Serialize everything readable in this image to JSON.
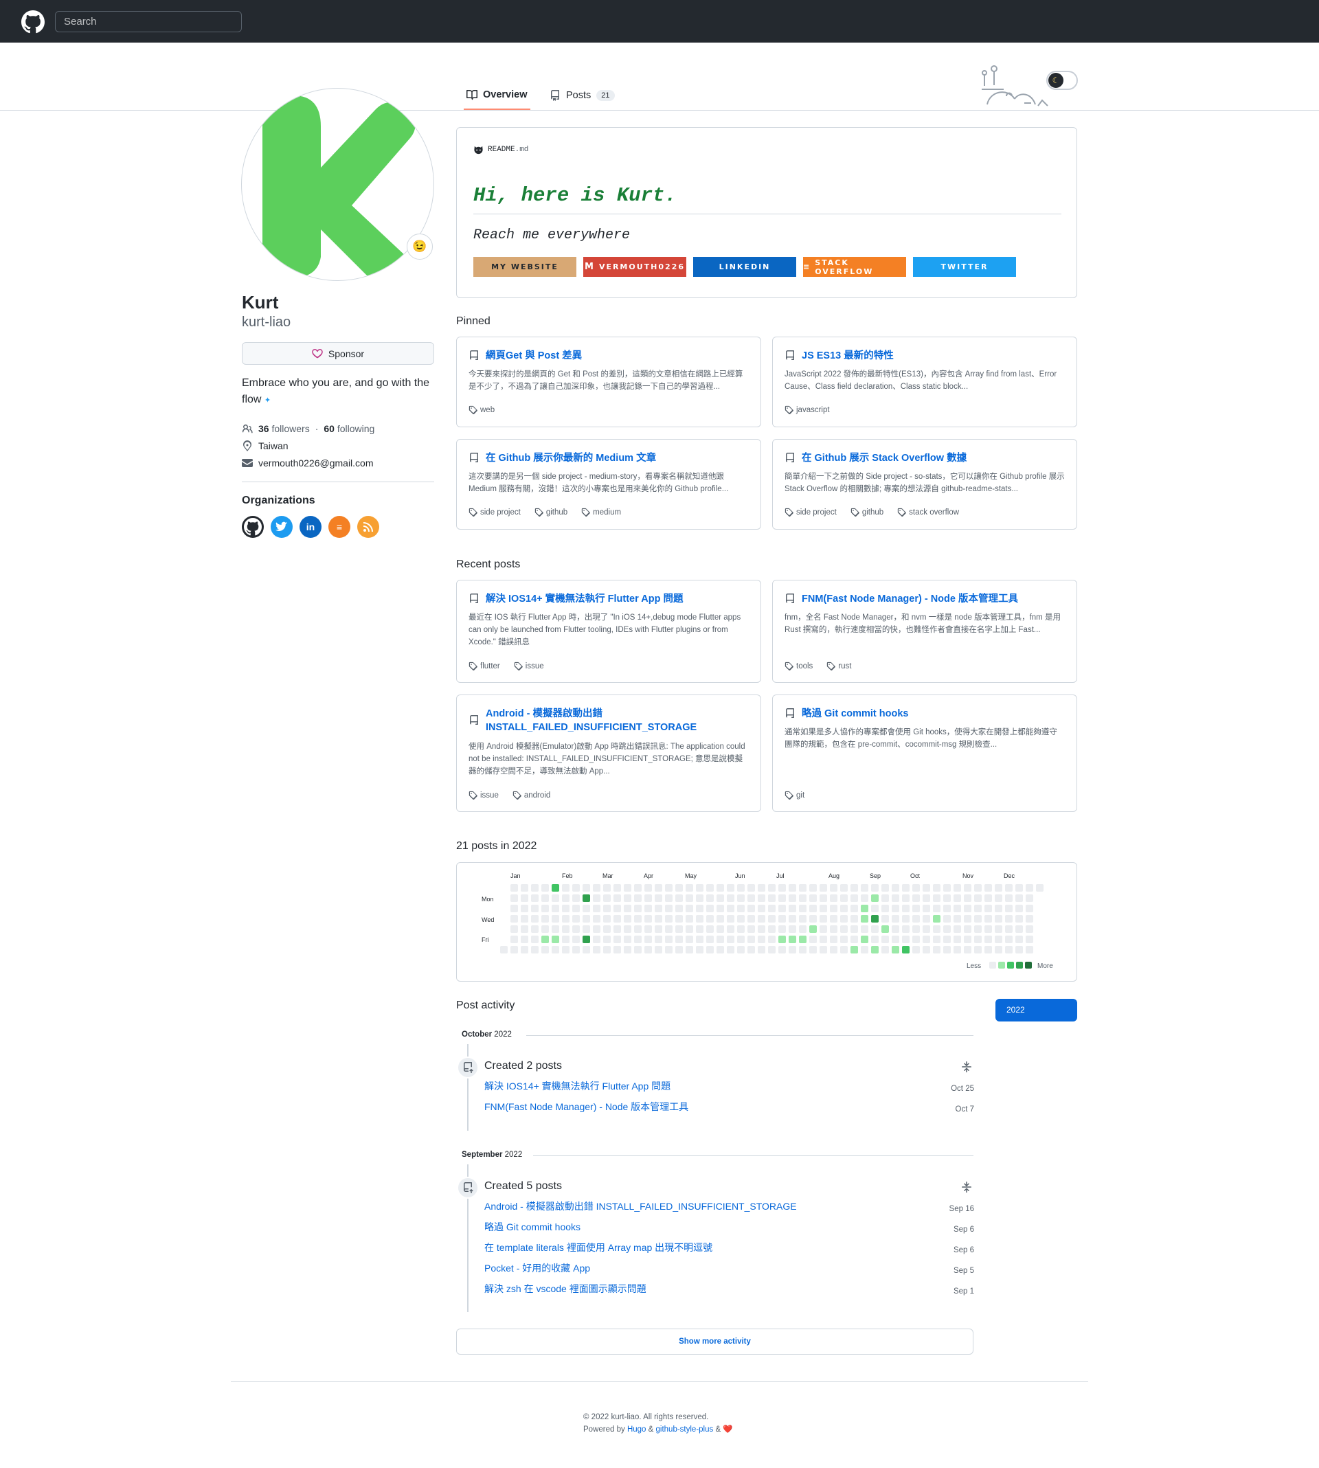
{
  "header": {
    "search_placeholder": "Search"
  },
  "tabs": [
    {
      "label": "Overview"
    },
    {
      "label": "Posts",
      "count": "21"
    }
  ],
  "profile": {
    "name": "Kurt",
    "login": "kurt-liao",
    "status_emoji": "😉",
    "sponsor_label": "Sponsor",
    "bio": "Embrace who you are, and go with the flow",
    "bio_emoji": "✦",
    "followers_count": "36",
    "followers_label": "followers",
    "following_count": "60",
    "following_label": "following",
    "location": "Taiwan",
    "email": "vermouth0226@gmail.com"
  },
  "organizations": {
    "title": "Organizations",
    "items": [
      {
        "name": "github",
        "glyph": "",
        "color": "#24292f"
      },
      {
        "name": "twitter",
        "glyph": "t",
        "color": "#1d9bf0"
      },
      {
        "name": "linkedin",
        "glyph": "in",
        "color": "#0a66c2"
      },
      {
        "name": "stackoverflow",
        "glyph": "≡",
        "color": "#f48024"
      },
      {
        "name": "rss",
        "glyph": "⁾",
        "color": "#f7a032"
      }
    ]
  },
  "readme": {
    "file": "README",
    "ext": ".md",
    "heading": "Hi, here is Kurt.",
    "subheading": "Reach me everywhere",
    "badges": [
      {
        "label": "MY WEBSITE",
        "color": "#d8a874",
        "text_color": "#24292f"
      },
      {
        "label": "VERMOUTH0226",
        "color": "#d44638",
        "text_color": "#ffffff"
      },
      {
        "label": "LINKEDIN",
        "color": "#0a66c2",
        "text_color": "#ffffff"
      },
      {
        "label": "STACK OVERFLOW",
        "color": "#f48024",
        "text_color": "#ffffff"
      },
      {
        "label": "TWITTER",
        "color": "#1da1f2",
        "text_color": "#ffffff"
      }
    ]
  },
  "pinned": {
    "title": "Pinned",
    "items": [
      {
        "title": "網頁Get 與 Post 差異",
        "desc": "今天要來探討的是網頁的 Get 和 Post 的差別，這類的文章相信在網路上已經算是不少了，不過為了讓自己加深印象，也讓我記錄一下自己的學習過程...",
        "tags": [
          "web"
        ]
      },
      {
        "title": "JS ES13 最新的特性",
        "desc": "JavaScript 2022 發佈的最新特性(ES13)，內容包含 Array find from last、Error Cause、Class field declaration、Class static block...",
        "tags": [
          "javascript"
        ]
      },
      {
        "title": "在 Github 展示你最新的 Medium 文章",
        "desc": "這次要講的是另一個 side project - medium-story，看專案名稱就知道他跟 Medium 服務有關，沒錯！這次的小專案也是用來美化你的 Github profile...",
        "tags": [
          "side project",
          "github",
          "medium"
        ]
      },
      {
        "title": "在 Github 展示 Stack Overflow 數據",
        "desc": "簡單介紹一下之前做的 Side project - so-stats，它可以讓你在 Github profile 展示Stack Overflow 的相關數據; 專案的想法源自 github-readme-stats...",
        "tags": [
          "side project",
          "github",
          "stack overflow"
        ]
      }
    ]
  },
  "recent": {
    "title": "Recent posts",
    "items": [
      {
        "title": "解決 IOS14+ 實機無法執行 Flutter App 問題",
        "desc": "最近在 IOS 執行 Flutter App 時，出現了 \"In iOS 14+,debug mode Flutter apps can only be launched from Flutter tooling, IDEs with Flutter plugins or from Xcode.\" 錯誤訊息",
        "tags": [
          "flutter",
          "issue"
        ]
      },
      {
        "title": "FNM(Fast Node Manager) - Node 版本管理工具",
        "desc": "fnm，全名 Fast Node Manager，和 nvm 一樣是 node 版本管理工具，fnm 是用 Rust 撰寫的，執行速度相當的快，也難怪作者會直接在名字上加上 Fast...",
        "tags": [
          "tools",
          "rust"
        ]
      },
      {
        "title": "Android - 模擬器啟動出錯 INSTALL_FAILED_INSUFFICIENT_STORAGE",
        "desc": "使用 Android 模擬器(Emulator)啟動 App 時跳出錯誤訊息: The application could not be installed: INSTALL_FAILED_INSUFFICIENT_STORAGE; 意思是說模擬器的儲存空間不足，導致無法啟動 App...",
        "tags": [
          "issue",
          "android"
        ]
      },
      {
        "title": "略過 Git commit hooks",
        "desc": "通常如果是多人協作的專案都會使用 Git hooks，使得大家在開發上都能夠遵守團隊的規範，包含在 pre-commit、cocommit-msg 規則檢查...",
        "tags": [
          "git"
        ]
      }
    ]
  },
  "contributions": {
    "title": "21 posts in 2022",
    "months": [
      "Jan",
      "Feb",
      "Mar",
      "Apr",
      "May",
      "Jun",
      "Jul",
      "Aug",
      "Sep",
      "Oct",
      "Nov",
      "Dec"
    ],
    "days": [
      "Mon",
      "Wed",
      "Fri"
    ],
    "legend_less": "Less",
    "legend_more": "More",
    "colors": [
      "#ebedf0",
      "#9be9a8",
      "#40c463",
      "#30a14e",
      "#216e39"
    ],
    "active": [
      {
        "week": 5,
        "day": 0,
        "level": 2
      },
      {
        "week": 5,
        "day": 5,
        "level": 1
      },
      {
        "week": 4,
        "day": 5,
        "level": 1
      },
      {
        "week": 8,
        "day": 1,
        "level": 3
      },
      {
        "week": 8,
        "day": 5,
        "level": 3
      },
      {
        "week": 27,
        "day": 5,
        "level": 1
      },
      {
        "week": 28,
        "day": 5,
        "level": 1
      },
      {
        "week": 29,
        "day": 5,
        "level": 1
      },
      {
        "week": 30,
        "day": 4,
        "level": 1
      },
      {
        "week": 34,
        "day": 6,
        "level": 1
      },
      {
        "week": 35,
        "day": 2,
        "level": 1
      },
      {
        "week": 35,
        "day": 3,
        "level": 1
      },
      {
        "week": 35,
        "day": 5,
        "level": 1
      },
      {
        "week": 36,
        "day": 1,
        "level": 1
      },
      {
        "week": 36,
        "day": 3,
        "level": 3
      },
      {
        "week": 36,
        "day": 6,
        "level": 1
      },
      {
        "week": 37,
        "day": 4,
        "level": 1
      },
      {
        "week": 38,
        "day": 6,
        "level": 1
      },
      {
        "week": 39,
        "day": 6,
        "level": 2
      },
      {
        "week": 42,
        "day": 3,
        "level": 1
      }
    ]
  },
  "activity": {
    "title": "Post activity",
    "year": "2022",
    "groups": [
      {
        "month": "October",
        "month_year": "2022",
        "summary": "Created 2 posts",
        "items": [
          {
            "title": "解決 IOS14+ 實機無法執行 Flutter App 問題",
            "date": "Oct 25"
          },
          {
            "title": "FNM(Fast Node Manager) - Node 版本管理工具",
            "date": "Oct 7"
          }
        ]
      },
      {
        "month": "September",
        "month_year": "2022",
        "summary": "Created 5 posts",
        "items": [
          {
            "title": "Android - 模擬器啟動出錯 INSTALL_FAILED_INSUFFICIENT_STORAGE",
            "date": "Sep 16"
          },
          {
            "title": "略過 Git commit hooks",
            "date": "Sep 6"
          },
          {
            "title": "在 template literals 裡面使用 Array map 出現不明逗號",
            "date": "Sep 6"
          },
          {
            "title": "Pocket - 好用的收藏 App",
            "date": "Sep 5"
          },
          {
            "title": "解決 zsh 在 vscode 裡面圖示顯示問題",
            "date": "Sep 1"
          }
        ]
      }
    ],
    "show_more": "Show more activity"
  },
  "footer": {
    "copyright": "© 2022 kurt-liao. All rights reserved.",
    "powered_by": "Powered by",
    "hugo": "Hugo",
    "amp": "&",
    "theme": "github-style-plus",
    "amp2": "&",
    "heart": "❤️"
  }
}
